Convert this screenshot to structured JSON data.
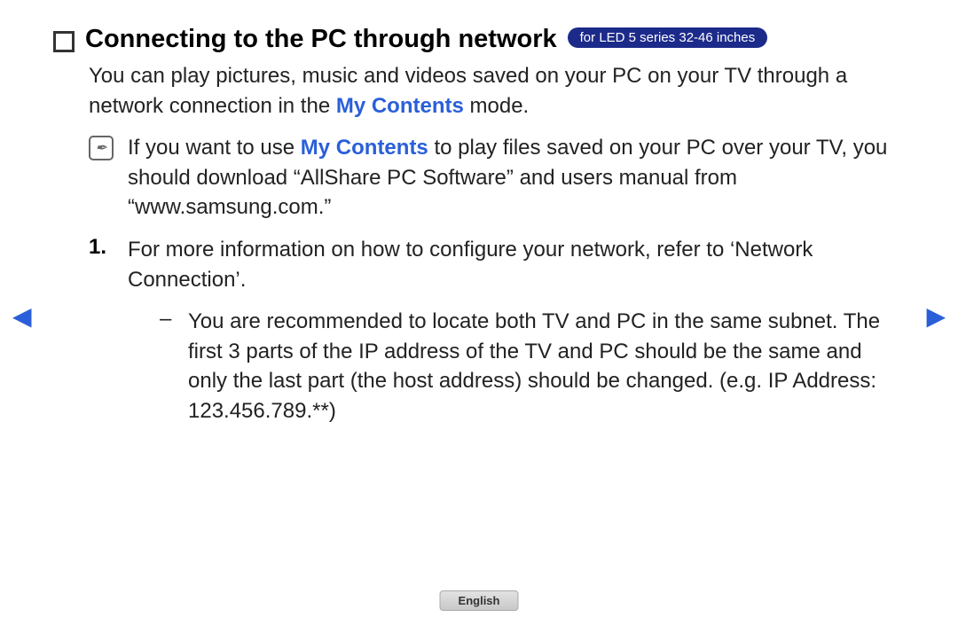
{
  "heading": {
    "title": "Connecting to the PC through network",
    "badge": "for LED 5 series 32-46 inches"
  },
  "intro": {
    "prefix": "You can play pictures, music and videos saved on your PC on your TV through a network connection in the ",
    "highlight": "My Contents",
    "suffix": " mode."
  },
  "note": {
    "prefix": "If you want to use ",
    "highlight": "My Contents",
    "suffix": " to play files saved on your PC over your TV, you should download “AllShare PC Software” and users manual from “www.samsung.com.”"
  },
  "step1": {
    "num": "1.",
    "text": "For more information on how to configure your network, refer to ‘Network Connection’."
  },
  "subitem": {
    "dash": "–",
    "text": "You are recommended to locate both TV and PC in the same subnet. The first 3 parts of the IP address of the TV and PC should be the same and only the last part (the host address) should be changed. (e.g. IP Address: 123.456.789.**)"
  },
  "arrows": {
    "left": "◀",
    "right": "▶"
  },
  "language": "English",
  "noteGlyph": "✒"
}
